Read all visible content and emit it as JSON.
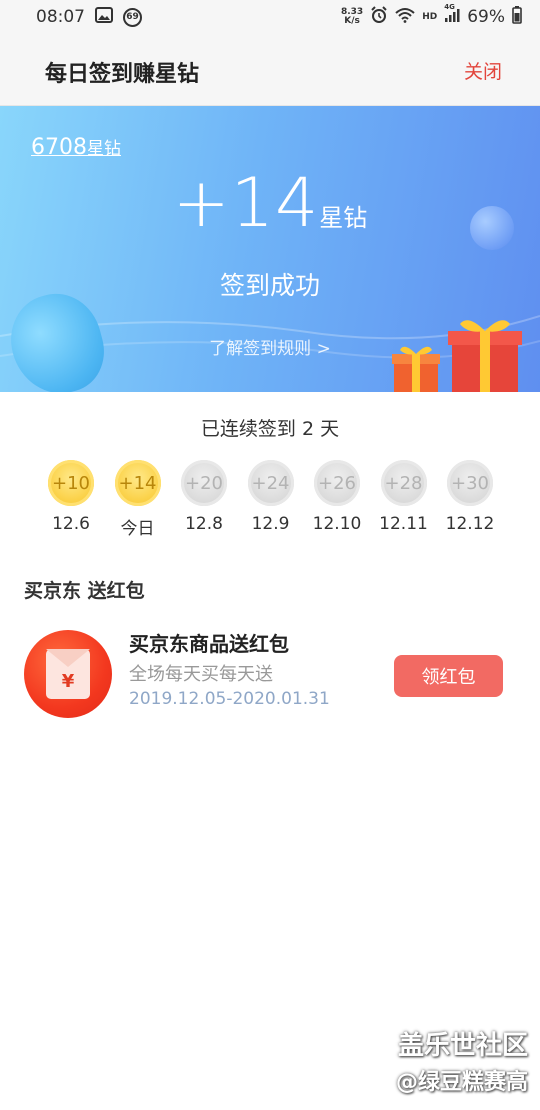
{
  "status_bar": {
    "time": "08:07",
    "notif_badge": "69",
    "net_speed_top": "8.33",
    "net_speed_bottom": "K/s",
    "network": "HD",
    "signal_tag": "4G",
    "battery": "69%"
  },
  "header": {
    "title": "每日签到赚星钻",
    "close_label": "关闭"
  },
  "hero": {
    "balance_value": "6708",
    "balance_unit": "星钻",
    "reward_value": "+14",
    "reward_unit": "星钻",
    "success_text": "签到成功",
    "rules_link": "了解签到规则 >"
  },
  "streak": {
    "text": "已连续签到 2 天",
    "days": [
      {
        "reward": "+10",
        "label": "12.6",
        "claimed": true
      },
      {
        "reward": "+14",
        "label": "今日",
        "claimed": true
      },
      {
        "reward": "+20",
        "label": "12.8",
        "claimed": false
      },
      {
        "reward": "+24",
        "label": "12.9",
        "claimed": false
      },
      {
        "reward": "+26",
        "label": "12.10",
        "claimed": false
      },
      {
        "reward": "+28",
        "label": "12.11",
        "claimed": false
      },
      {
        "reward": "+30",
        "label": "12.12",
        "claimed": false
      }
    ]
  },
  "promo_section": {
    "title": "买京东 送红包",
    "item": {
      "icon_symbol": "¥",
      "title": "买京东商品送红包",
      "subtitle": "全场每天买每天送",
      "date_range": "2019.12.05-2020.01.31",
      "button_label": "领红包"
    }
  },
  "watermark": {
    "line1": "盖乐世社区",
    "line2": "@绿豆糕赛高"
  },
  "colors": {
    "accent_red": "#e2453c",
    "button_red": "#f26a63",
    "coin_gold": "#fbd24a",
    "coin_grey": "#dcdcdc",
    "hero_start": "#89d6fb",
    "hero_end": "#5f8ff0"
  }
}
